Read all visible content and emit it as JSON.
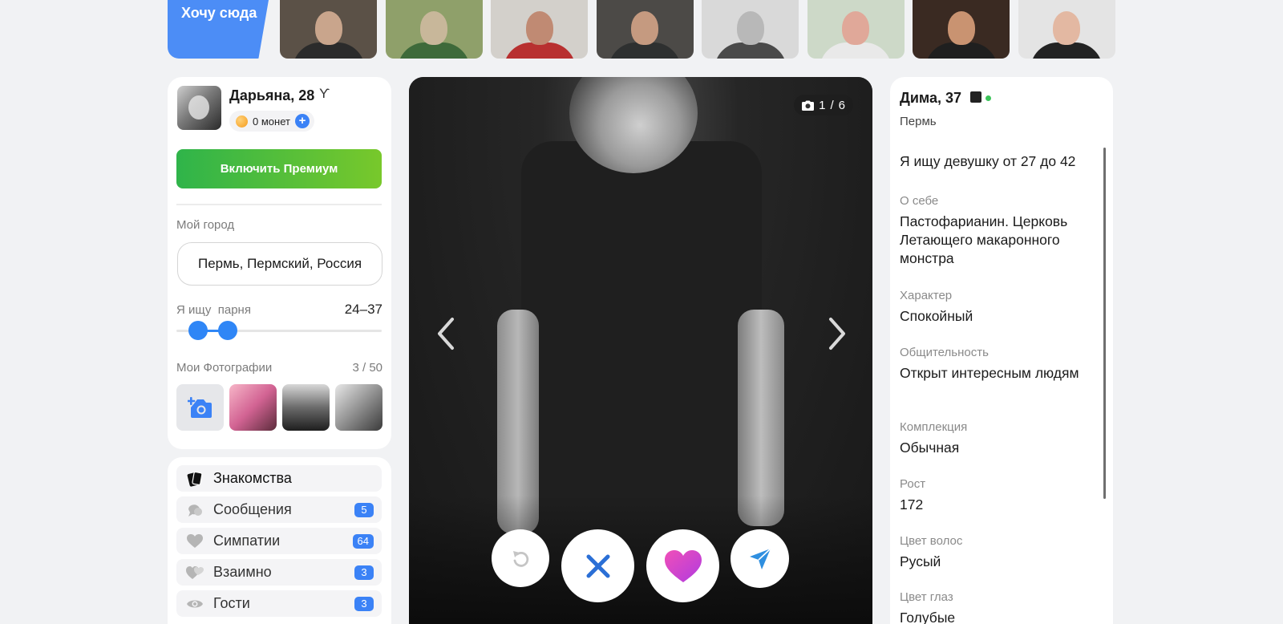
{
  "top_strip": {
    "want_here_label": "Хочу сюда",
    "thumbnails": [
      {
        "id": "t1",
        "bg": "#5b5147",
        "face": "#c9a58c",
        "body": "#2b2b2b"
      },
      {
        "id": "t2",
        "bg": "#8fa06a",
        "face": "#c8b79a",
        "body": "#3e6a3a"
      },
      {
        "id": "t3",
        "bg": "#d3d0cb",
        "face": "#c08a73",
        "body": "#b83030"
      },
      {
        "id": "t4",
        "bg": "#4c4a47",
        "face": "#c59a80",
        "body": "#2e3030"
      },
      {
        "id": "t5",
        "bg": "#d9d9d9",
        "face": "#b8b8b8",
        "body": "#4a4a4a"
      },
      {
        "id": "t6",
        "bg": "#cdd9c8",
        "face": "#e0a899",
        "body": "#e9e9e9"
      },
      {
        "id": "t7",
        "bg": "#3a2a22",
        "face": "#c99371",
        "body": "#1f1f1f"
      },
      {
        "id": "t8",
        "bg": "#e4e4e4",
        "face": "#e3b8a2",
        "body": "#232323"
      }
    ]
  },
  "profile": {
    "name_age": "Дарьяна, 28",
    "zodiac_icon": "ϒ",
    "coins_label": "0 монет",
    "premium_button": "Включить Премиум",
    "city_label": "Мой город",
    "city_value": "Пермь, Пермский, Россия",
    "seeking_label": "Я ищу  парня",
    "age_range": "24–37",
    "age_slider": {
      "min": 18,
      "max": 99,
      "low": 24,
      "high": 37
    },
    "photos_label": "Мои Фотографии",
    "photos_count": "3 / 50",
    "my_photos": [
      {
        "bg": "linear-gradient(135deg,#f7b6c8,#d26393 50%,#5c2c3b)"
      },
      {
        "bg": "linear-gradient(180deg,#d8d8d8,#6b6b6b 50%,#1e1e1e)"
      },
      {
        "bg": "linear-gradient(135deg,#e8e8e8,#9a9a9a 45%,#3a3a3a)"
      }
    ]
  },
  "menu": [
    {
      "label": "Знакомства",
      "icon": "cards-icon",
      "badge": null,
      "active": true
    },
    {
      "label": "Сообщения",
      "icon": "chat-icon",
      "badge": "5"
    },
    {
      "label": "Симпатии",
      "icon": "heart-icon",
      "badge": "64"
    },
    {
      "label": "Взаимно",
      "icon": "double-heart-icon",
      "badge": "3"
    },
    {
      "label": "Гости",
      "icon": "eye-icon",
      "badge": "3"
    }
  ],
  "photo": {
    "counter_current": "1",
    "counter_sep": "/",
    "counter_total": "6"
  },
  "details": {
    "name_age": "Дима, 37",
    "city": "Пермь",
    "looking_for": "Я ищу девушку от 27 до 42",
    "sections": [
      {
        "key": "О себе",
        "value": "Пастофарианин. Церковь Летающего макаронного монстра"
      },
      {
        "key": "Характер",
        "value": "Спокойный"
      },
      {
        "key": "Общительность",
        "value": "Открыт интересным людям"
      },
      {
        "key": "Комплекция",
        "value": "Обычная"
      },
      {
        "key": "Рост",
        "value": "172"
      },
      {
        "key": "Цвет волос",
        "value": "Русый"
      },
      {
        "key": "Цвет глаз",
        "value": "Голубые"
      }
    ]
  },
  "colors": {
    "accent_blue": "#3b82f6",
    "premium_green": "#2fb44a",
    "like_pink": "#d63ae0"
  }
}
